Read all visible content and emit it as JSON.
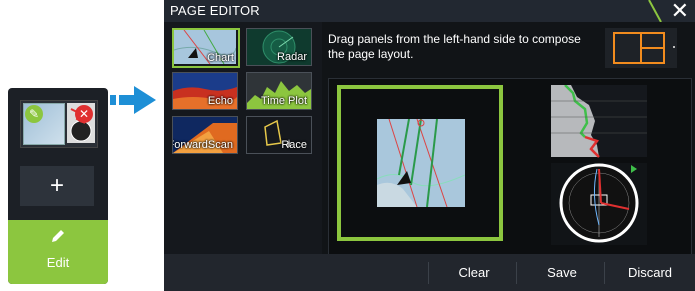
{
  "mini": {
    "add_label": "+",
    "edit_label": "Edit"
  },
  "editor": {
    "title": "PAGE EDITOR",
    "instructions": "Drag panels from the left-hand side to compose the page layout.",
    "panels": [
      {
        "label": "Chart",
        "selected": true
      },
      {
        "label": "Radar"
      },
      {
        "label": "Echo"
      },
      {
        "label": "Time Plot"
      },
      {
        "label": "ForwardScan"
      },
      {
        "label": "Race"
      }
    ],
    "buttons": {
      "clear": "Clear",
      "save": "Save",
      "discard": "Discard"
    }
  },
  "colors": {
    "accent": "#8cc63f",
    "close_red": "#e03030",
    "layout_orange": "#f28c1e",
    "arrow_blue": "#1e8fd6"
  },
  "icons": [
    "wrench-icon",
    "close-icon",
    "plus-icon",
    "pencil-icon",
    "arrow-right-icon",
    "layout-icon"
  ]
}
